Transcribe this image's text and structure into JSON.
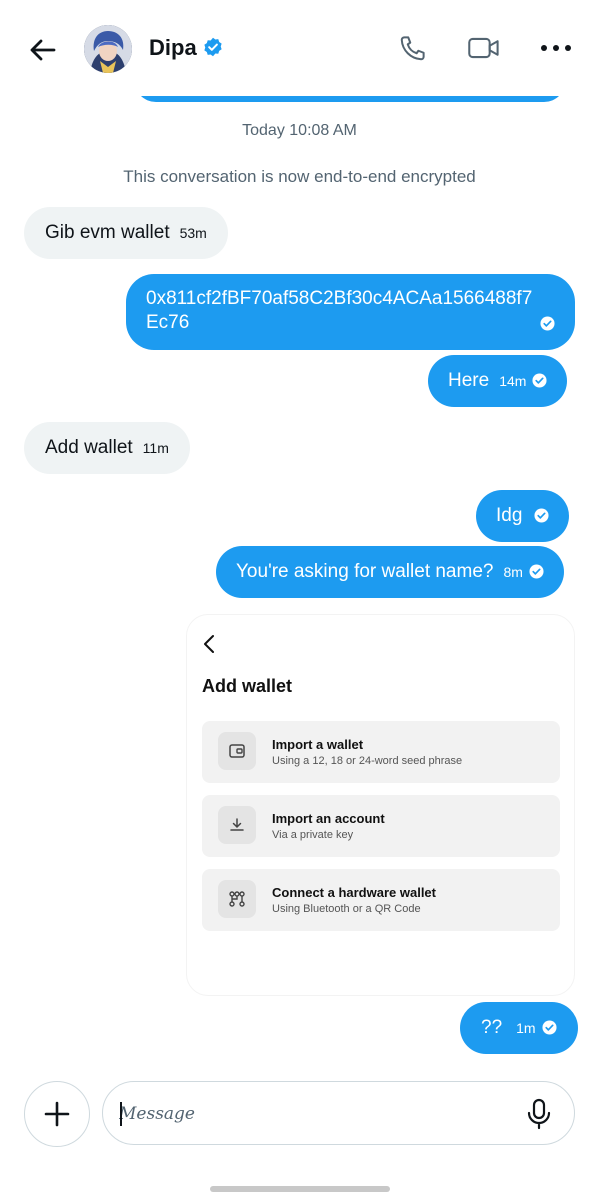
{
  "header": {
    "contact_name": "Dipa",
    "verified": true,
    "icons": [
      "back-arrow-icon",
      "phone-icon",
      "video-icon",
      "more-icon"
    ]
  },
  "conversation": {
    "timestamp": "Today 10:08 AM",
    "encryption_notice": "This conversation is now end-to-end encrypted",
    "messages": [
      {
        "direction": "incoming",
        "text": "Gib evm wallet",
        "time": "53m"
      },
      {
        "direction": "outgoing",
        "text_line1": "0x811cf2fBF70af58C2Bf30c4ACAa1566488f7",
        "text_line2": "Ec76",
        "time": ""
      },
      {
        "direction": "outgoing",
        "text": "Here",
        "time": "14m"
      },
      {
        "direction": "incoming",
        "text": "Add wallet",
        "time": "11m"
      },
      {
        "direction": "outgoing",
        "text": "Idg",
        "time": ""
      },
      {
        "direction": "outgoing",
        "text": "You're asking for wallet name?",
        "time": "8m"
      },
      {
        "direction": "outgoing",
        "text": "??",
        "time": "1m"
      }
    ]
  },
  "shared_image": {
    "title": "Add wallet",
    "options": [
      {
        "title": "Import a wallet",
        "subtitle": "Using a 12, 18 or 24-word seed phrase",
        "icon": "wallet-icon"
      },
      {
        "title": "Import an account",
        "subtitle": "Via a private key",
        "icon": "download-icon"
      },
      {
        "title": "Connect a hardware wallet",
        "subtitle": "Using Bluetooth or a QR Code",
        "icon": "hardware-icon"
      }
    ]
  },
  "composer": {
    "placeholder": "Message"
  },
  "colors": {
    "accent": "#1d9bf0",
    "incoming_bubble": "#eff3f4",
    "secondary_text": "#536471"
  }
}
